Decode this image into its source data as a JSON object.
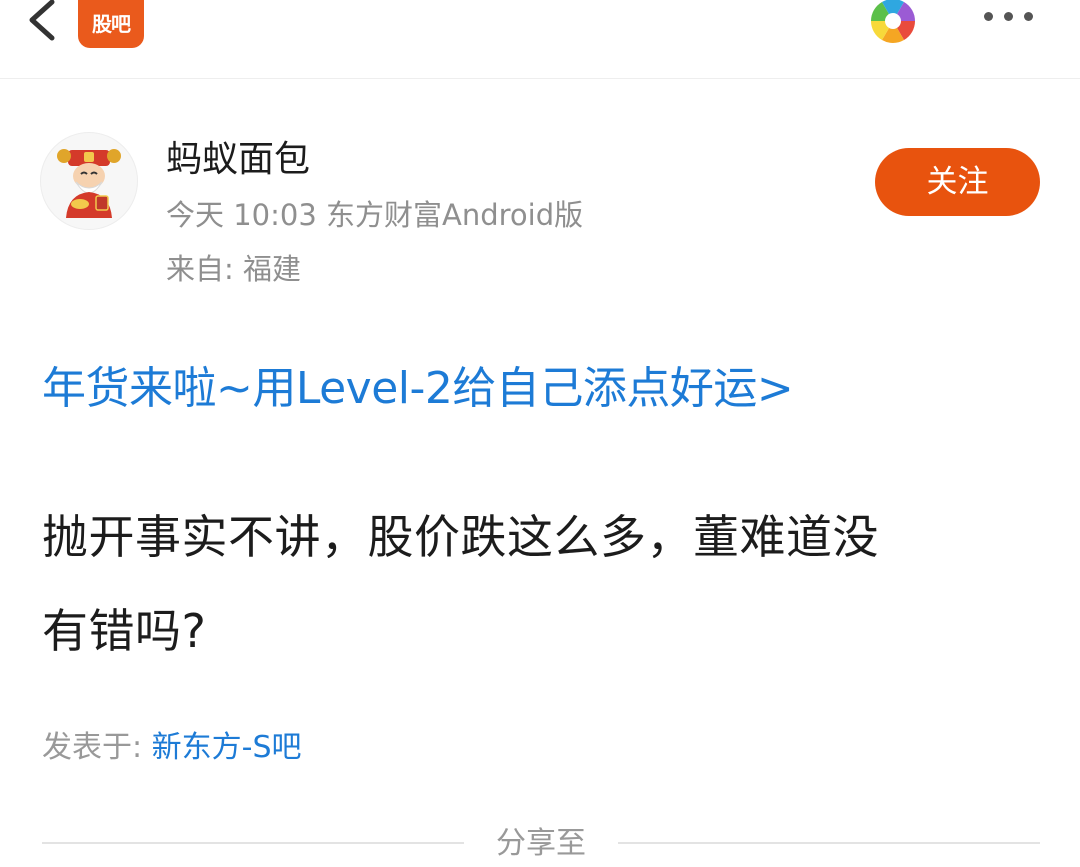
{
  "topbar": {
    "back_icon": "chevron-left-icon",
    "app_badge_text": "股吧",
    "share_icon": "camera-shutter-icon",
    "more_icon": "more-dots-icon",
    "brand_color": "#ea5a1c"
  },
  "author": {
    "name": "蚂蚁面包",
    "post_time": "今天 10:03",
    "client": "东方财富Android版",
    "location_label": "来自:",
    "location": "福建",
    "follow_label": "关注",
    "follow_color": "#e8530e"
  },
  "content": {
    "promo_link": "年货来啦~用Level-2给自己添点好运>",
    "body_line1": "抛开事实不讲，股价跌这么多，董难道没",
    "body_line2": "有错吗?",
    "posted_in_label": "发表于:",
    "board_name": "新东方-S吧",
    "link_color": "#1d7bd6"
  },
  "share": {
    "label": "分享至"
  }
}
